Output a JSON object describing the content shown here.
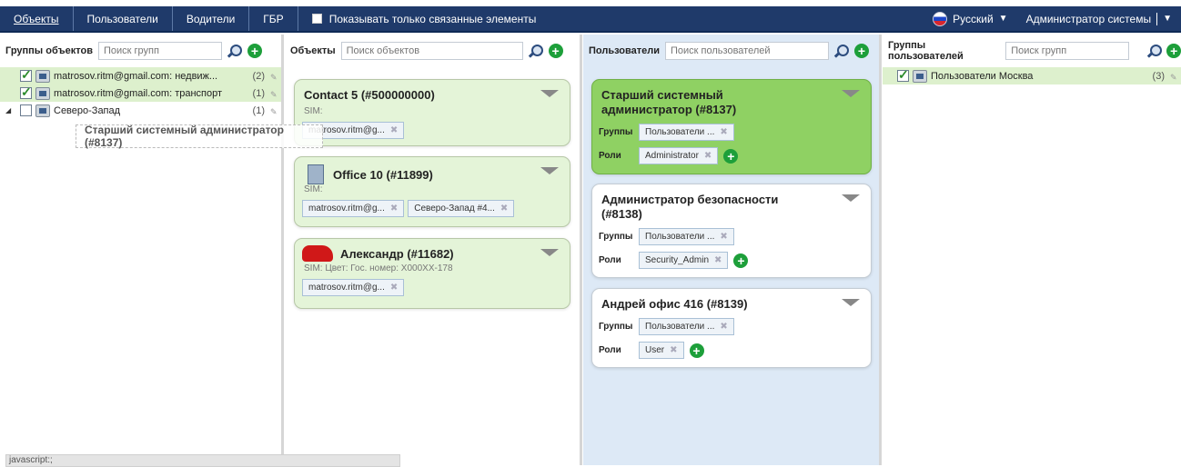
{
  "nav": {
    "tabs": [
      "Объекты",
      "Пользователи",
      "Водители",
      "ГБР"
    ],
    "active_tab": "Объекты",
    "show_linked_label": "Показывать только связанные элементы",
    "language": "Русский",
    "user": "Администратор системы"
  },
  "col1": {
    "title": "Группы объектов",
    "placeholder": "Поиск групп",
    "rows": [
      {
        "label": "matrosov.ritm@gmail.com: недвиж...",
        "count": "(2)"
      },
      {
        "label": "matrosov.ritm@gmail.com: транспорт",
        "count": "(1)"
      },
      {
        "label": "Северо-Запад",
        "count": "(1)"
      }
    ]
  },
  "drag_label": "Старший системный администратор (#8137)",
  "col2": {
    "title": "Объекты",
    "placeholder": "Поиск объектов",
    "cards": [
      {
        "title": "Contact 5 (#500000000)",
        "sim": "SIM:",
        "chips": [
          "matrosov.ritm@g..."
        ]
      },
      {
        "title": "Office 10 (#11899)",
        "sim": "SIM:",
        "chips": [
          "matrosov.ritm@g...",
          "Северо-Запад #4..."
        ]
      },
      {
        "title": "Александр (#11682)",
        "sim": "SIM:   Цвет:   Гос. номер: Х000ХХ-178",
        "chips": [
          "matrosov.ritm@g..."
        ]
      }
    ]
  },
  "col3": {
    "title": "Пользователи",
    "placeholder": "Поиск пользователей",
    "groups_label": "Группы",
    "roles_label": "Роли",
    "cards": [
      {
        "title": "Старший системный администратор (#8137)",
        "group": "Пользователи ...",
        "role": "Administrator"
      },
      {
        "title": "Администратор безопасности (#8138)",
        "group": "Пользователи ...",
        "role": "Security_Admin"
      },
      {
        "title": "Андрей офис 416 (#8139)",
        "group": "Пользователи ...",
        "role": "User"
      }
    ]
  },
  "col4": {
    "title": "Группы пользователей",
    "placeholder": "Поиск групп",
    "rows": [
      {
        "label": "Пользователи Москва",
        "count": "(3)"
      }
    ]
  },
  "status_text": "javascript:;"
}
